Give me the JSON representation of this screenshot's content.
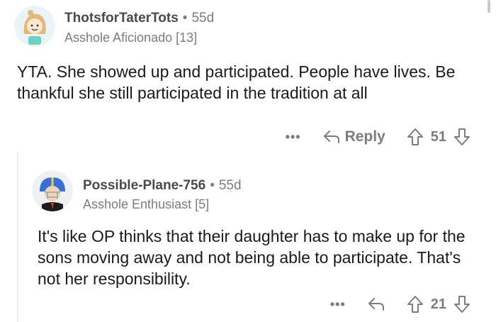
{
  "comments": [
    {
      "username": "ThotsforTaterTots",
      "separator": "•",
      "age": "55d",
      "flair": "Asshole Aficionado [13]",
      "body": "YTA. She showed up and participated. People have lives. Be thankful she still participated in the tradition at all",
      "more_label": "•••",
      "reply_label": "Reply",
      "score": "51"
    },
    {
      "username": "Possible-Plane-756",
      "separator": "•",
      "age": "55d",
      "flair": "Asshole Enthusiast [5]",
      "body": "It's like OP thinks that their daughter has to make up for the sons moving away and not being able to participate. That's not her responsibility.",
      "more_label": "•••",
      "score": "21"
    }
  ],
  "icons": {
    "reply": "reply-arrow-icon",
    "upvote": "upvote-arrow-icon",
    "downvote": "downvote-arrow-icon"
  },
  "colors": {
    "meta_text": "#7c7c7c",
    "body_text": "#1a1a1b",
    "thread_line": "#edeff1"
  }
}
